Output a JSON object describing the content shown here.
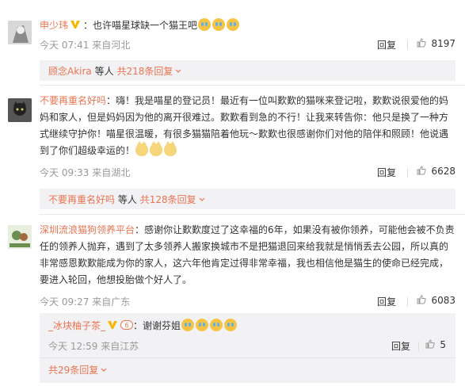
{
  "comments": [
    {
      "username": "申少玮",
      "text": "：也许喵星球缺一个猫王吧",
      "time": "今天 07:41 来自河北",
      "reply_label": "回复",
      "like_count": "8197",
      "sub": {
        "username": "顾念Akira",
        "middle": "等人",
        "count": "共218条回复"
      }
    },
    {
      "username": "不要再重名好吗",
      "text": "：嗨！我是喵星的登记员！最近有一位叫歎歎的猫咪来登记啦，歎歎说很爱他的妈妈和家人，但是妈妈因为他的离开很难过。歎歎看到急的不行！让我来转告你：他只是换了一种方式继续守护你！喵星很温暖，有很多猫猫陪着他玩～歎歎也很感谢你们对他的陪伴和照顾！他说遇到了你们超级幸运的！",
      "time": "今天 09:33 来自湖北",
      "reply_label": "回复",
      "like_count": "6628",
      "sub": {
        "username": "不要再重名好吗",
        "middle": "等人",
        "count": "共128条回复"
      }
    },
    {
      "username": "深圳流浪猫狗领养平台",
      "text": "：感谢你让歎歎度过了这幸福的6年，如果没有被你领养，可能他会被不负责任的领养人抛弃，遇到了太多领养人搬家换城市不是把猫退回来给我就是悄悄丢去公园，所以真的非常感恩歎歎能成为你的家人，这六年他肯定过得非常幸福，我也相信他是猫生的使命已经完成，要进入轮回，他想投胎做个好人了。",
      "time": "今天 09:27 来自广东",
      "reply_label": "回复",
      "like_count": "6083",
      "sub": {
        "username": "_冰块柚子茶_",
        "text": "：谢谢芬姐",
        "time": "今天 12:59 来自江苏",
        "reply_label": "回复",
        "like_count": "5",
        "count": "共29条回复"
      }
    }
  ],
  "colors": {
    "accent": "#eb7350",
    "muted": "#999999",
    "subbox": "#f2f2f5"
  }
}
